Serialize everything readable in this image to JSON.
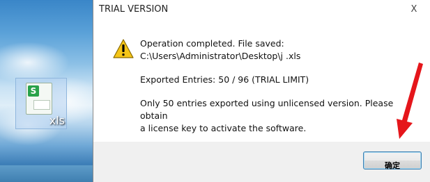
{
  "desktop": {
    "file_icon": {
      "label": "xls",
      "badge": "S",
      "icon": "spreadsheet-file-icon"
    }
  },
  "dialog": {
    "title": "TRIAL VERSION",
    "close_glyph": "X",
    "icon": "warning-icon",
    "message": {
      "line1": "Operation completed. File saved:",
      "line2": "C:\\Users\\Administrator\\Desktop\\j        .xls",
      "line3": "Exported Entries: 50 / 96 (TRIAL LIMIT)",
      "line4": "Only 50 entries exported using unlicensed version. Please obtain",
      "line5": "a license key to activate the software."
    },
    "ok_label": "确定"
  },
  "annotation": {
    "arrow_color": "#e5161b"
  }
}
